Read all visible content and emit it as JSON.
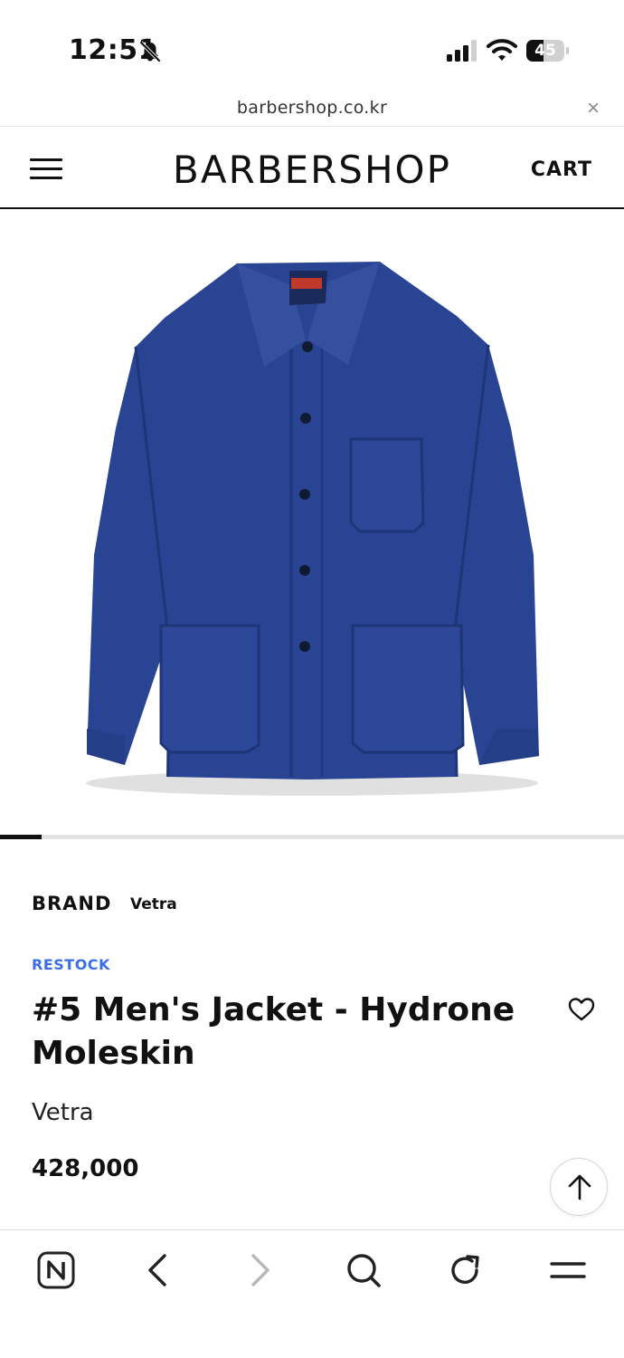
{
  "status_bar": {
    "time": "12:51",
    "battery": "45",
    "battery_level": 0.45,
    "icons": [
      "bell-off-icon",
      "signal-icon",
      "wifi-icon",
      "battery-icon"
    ]
  },
  "browser": {
    "url": "barbershop.co.kr",
    "close_symbol": "×"
  },
  "header": {
    "logo": "BARBERSHOP",
    "cart_label": "CART"
  },
  "product": {
    "brand_label": "BRAND",
    "brand_value": "Vetra",
    "badge": "RESTOCK",
    "title": "#5 Men's Jacket - Hydrone Moleskin",
    "brand_sub": "Vetra",
    "price": "428,000",
    "carousel_position": 0.067
  },
  "colors": {
    "accent": "#3b6ee6",
    "jacket": "#2a4494",
    "text": "#111111"
  },
  "toolbar": {
    "icons": [
      "naver-home-icon",
      "back-icon",
      "forward-icon",
      "search-icon",
      "refresh-icon",
      "menu-icon"
    ]
  }
}
